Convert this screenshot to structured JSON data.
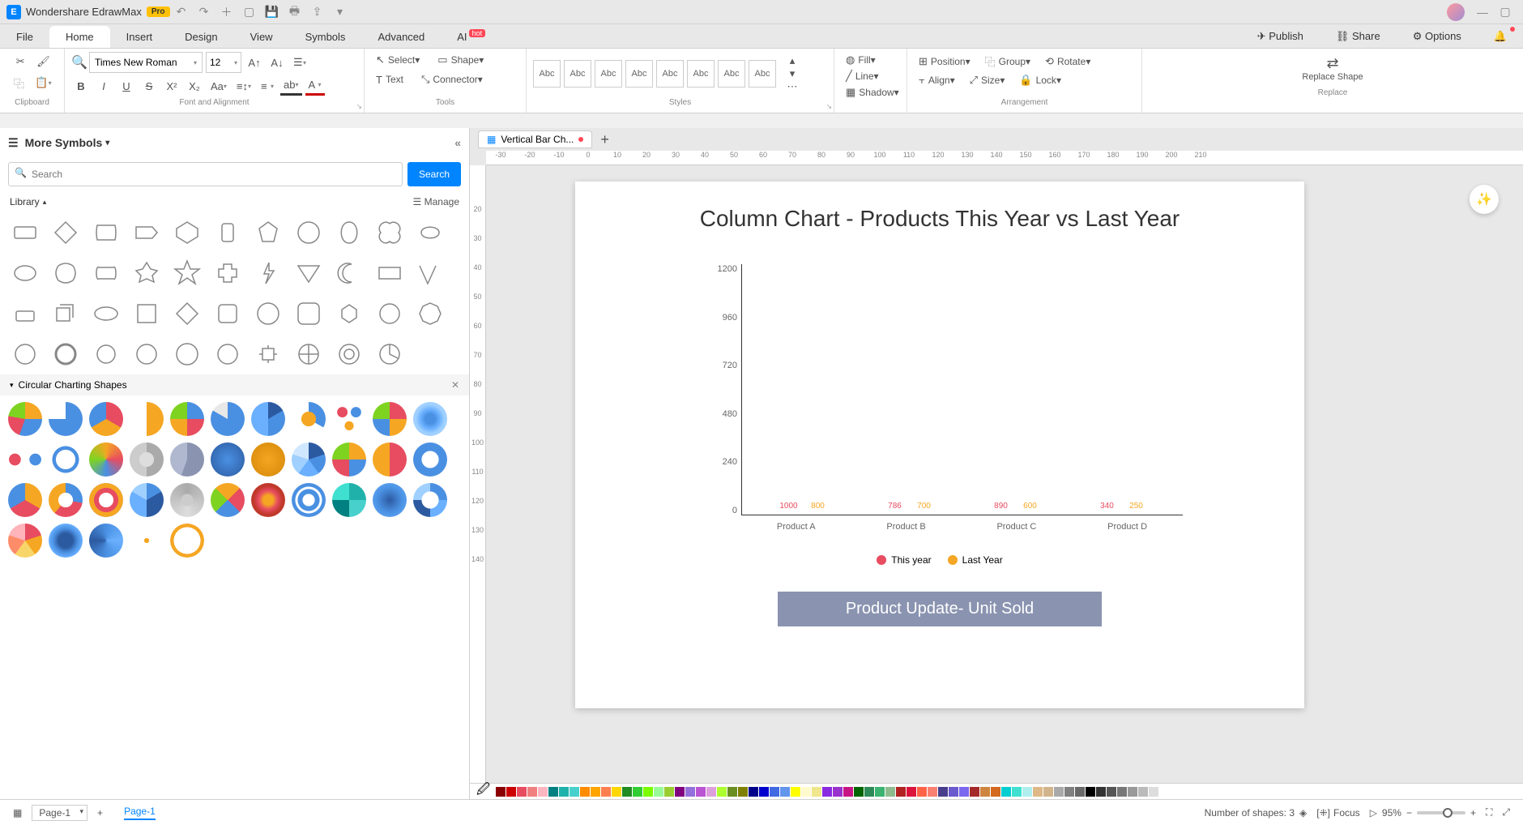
{
  "app": {
    "name": "Wondershare EdrawMax",
    "pro": "Pro"
  },
  "menu": {
    "file": "File",
    "home": "Home",
    "insert": "Insert",
    "design": "Design",
    "view": "View",
    "symbols": "Symbols",
    "advanced": "Advanced",
    "ai": "AI",
    "hot": "hot"
  },
  "top_right": {
    "publish": "Publish",
    "share": "Share",
    "options": "Options"
  },
  "ribbon": {
    "font": "Times New Roman",
    "size": "12",
    "select": "Select",
    "shape": "Shape",
    "text": "Text",
    "connector": "Connector",
    "style": "Abc",
    "fill": "Fill",
    "line": "Line",
    "shadow": "Shadow",
    "position": "Position",
    "group": "Group",
    "rotate": "Rotate",
    "align": "Align",
    "size_lbl": "Size",
    "lock": "Lock",
    "replace_shape": "Replace Shape",
    "labels": {
      "clipboard": "Clipboard",
      "font": "Font and Alignment",
      "tools": "Tools",
      "styles": "Styles",
      "arrangement": "Arrangement",
      "replace": "Replace"
    }
  },
  "panel": {
    "title": "More Symbols",
    "search_ph": "Search",
    "search_btn": "Search",
    "library": "Library",
    "manage": "Manage",
    "section": "Circular Charting Shapes"
  },
  "doc_tab": "Vertical Bar Ch...",
  "ruler_h": [
    "-30",
    "-20",
    "-10",
    "0",
    "10",
    "20",
    "30",
    "40",
    "50",
    "60",
    "70",
    "80",
    "90",
    "100",
    "110",
    "120",
    "130",
    "140",
    "150",
    "160",
    "170",
    "180",
    "190",
    "200",
    "210"
  ],
  "ruler_v": [
    "",
    "20",
    "30",
    "40",
    "50",
    "60",
    "70",
    "80",
    "90",
    "100",
    "110",
    "120",
    "130",
    "140"
  ],
  "chart_data": {
    "type": "bar",
    "title": "Column Chart - Products This Year vs Last Year",
    "subtitle": "Product Update- Unit Sold",
    "categories": [
      "Product A",
      "Product B",
      "Product C",
      "Product D"
    ],
    "series": [
      {
        "name": "This year",
        "color": "#e74c60",
        "values": [
          1000,
          786,
          890,
          340
        ]
      },
      {
        "name": "Last Year",
        "color": "#f5a623",
        "values": [
          800,
          700,
          600,
          250
        ]
      }
    ],
    "y_ticks": [
      "1200",
      "960",
      "720",
      "480",
      "240",
      "0"
    ],
    "ylim": [
      0,
      1200
    ]
  },
  "color_palette": [
    "#8b0000",
    "#c00",
    "#e74c60",
    "#f08080",
    "#ffb6c1",
    "#008080",
    "#20b2aa",
    "#48d1cc",
    "#ff8c00",
    "#ffa500",
    "#ff7f50",
    "#ffd700",
    "#228b22",
    "#32cd32",
    "#7cfc00",
    "#98fb98",
    "#9acd32",
    "#800080",
    "#9370db",
    "#ba55d3",
    "#dda0dd",
    "#adff2f",
    "#6b8e23",
    "#808000",
    "#00008b",
    "#0000cd",
    "#4169e1",
    "#6495ed",
    "#ffff00",
    "#fffacd",
    "#f0e68c",
    "#8a2be2",
    "#9932cc",
    "#c71585",
    "#006400",
    "#2e8b57",
    "#3cb371",
    "#8fbc8f",
    "#b22222",
    "#dc143c",
    "#ff6347",
    "#fa8072",
    "#483d8b",
    "#6a5acd",
    "#7b68ee",
    "#a52a2a",
    "#cd853f",
    "#d2691e",
    "#00ced1",
    "#40e0d0",
    "#afeeee",
    "#deb887",
    "#d2b48c",
    "#a9a9a9",
    "#808080",
    "#696969",
    "#000",
    "#333",
    "#555",
    "#777",
    "#999",
    "#bbb",
    "#ddd"
  ],
  "status": {
    "shapes": "Number of shapes: 3",
    "focus": "Focus",
    "zoom": "95%",
    "page": "Page-1",
    "page_tab": "Page-1"
  }
}
